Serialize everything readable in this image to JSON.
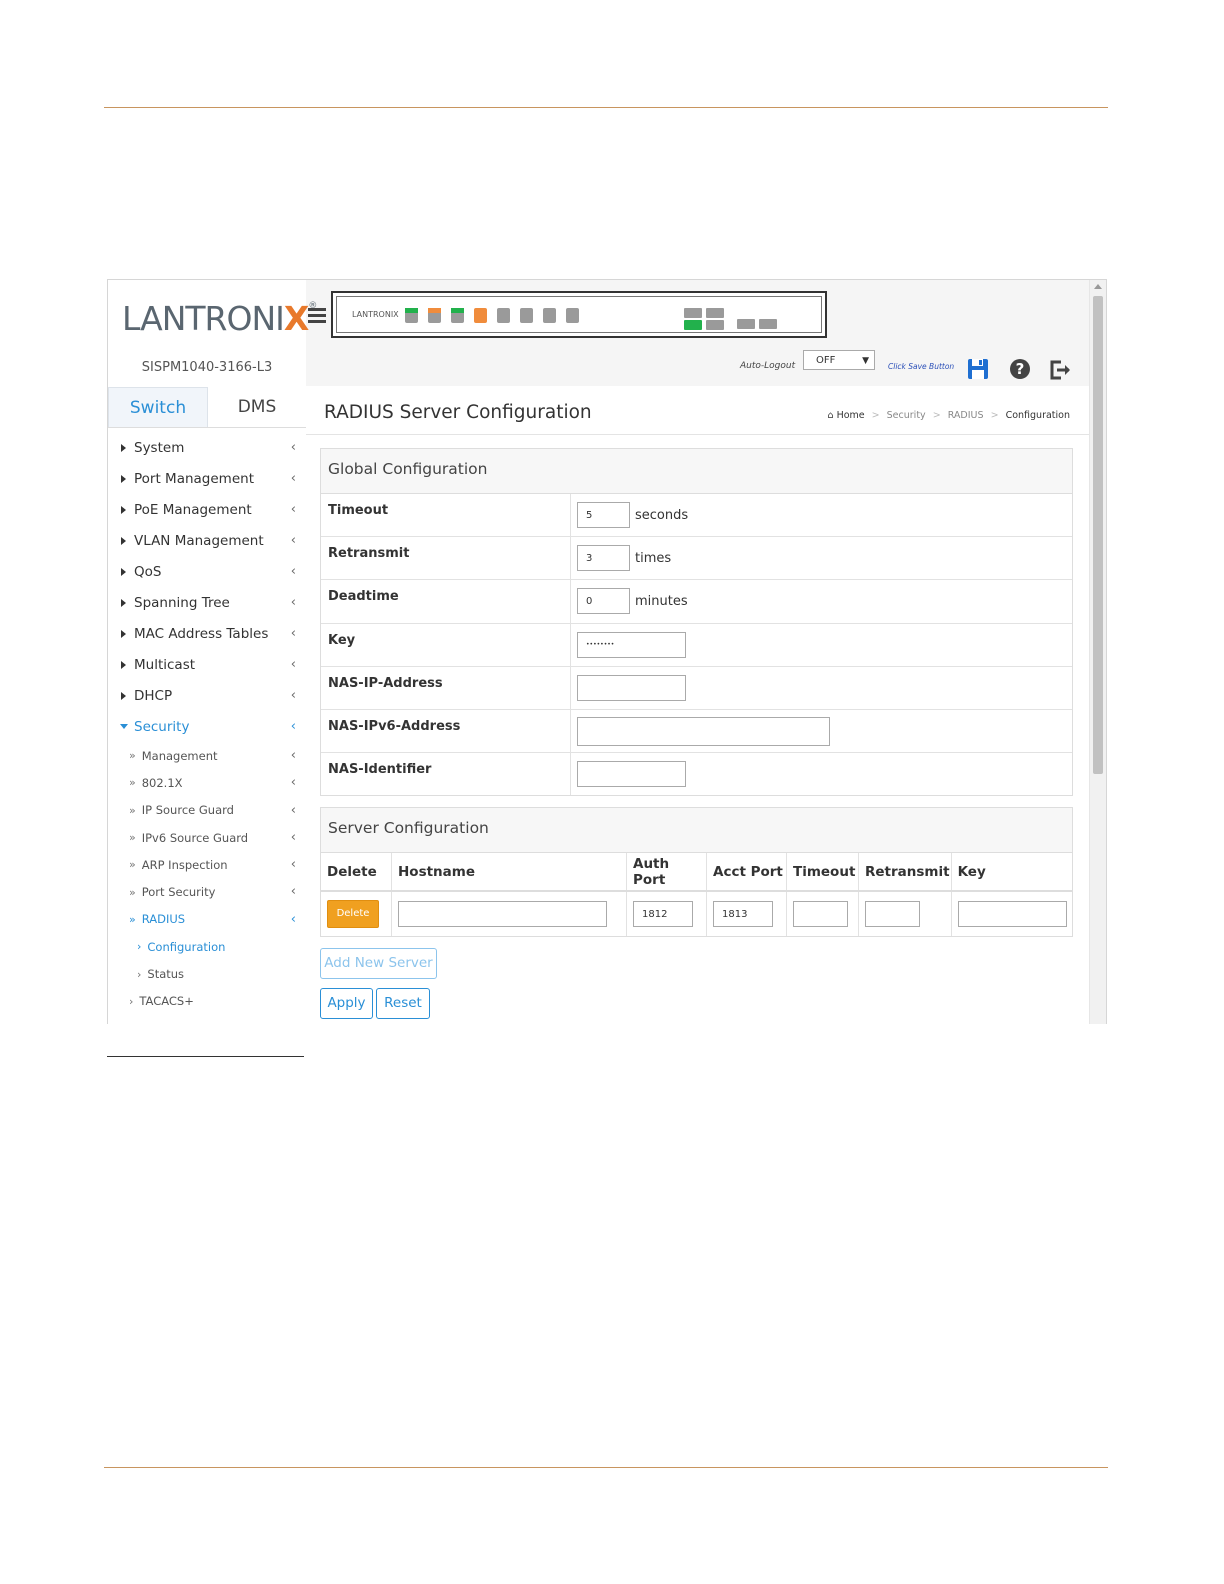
{
  "sidebar": {
    "logo_text": "LANTRONI",
    "logo_x": "X",
    "logo_reg": "®",
    "model": "SISPM1040-3166-L3",
    "tabs": [
      "Switch",
      "DMS"
    ],
    "nav": [
      {
        "label": "System"
      },
      {
        "label": "Port Management"
      },
      {
        "label": "PoE Management"
      },
      {
        "label": "VLAN Management"
      },
      {
        "label": "QoS"
      },
      {
        "label": "Spanning Tree"
      },
      {
        "label": "MAC Address Tables"
      },
      {
        "label": "Multicast"
      },
      {
        "label": "DHCP"
      },
      {
        "label": "Security"
      }
    ],
    "security_sub": [
      {
        "label": "Management"
      },
      {
        "label": "802.1X"
      },
      {
        "label": "IP Source Guard"
      },
      {
        "label": "IPv6 Source Guard"
      },
      {
        "label": "ARP Inspection"
      },
      {
        "label": "Port Security"
      },
      {
        "label": "RADIUS"
      }
    ],
    "radius_sub": [
      {
        "label": "Configuration"
      },
      {
        "label": "Status"
      }
    ],
    "tacacs": "TACACS+",
    "chevron": "‹"
  },
  "header": {
    "panel_logo": "LANTRONIX",
    "auto_logout_label": "Auto-Logout",
    "auto_logout_value": "OFF",
    "save_hint": "Click Save Button"
  },
  "page": {
    "title": "RADIUS Server Configuration",
    "breadcrumb": [
      "Home",
      "Security",
      "RADIUS",
      "Configuration"
    ],
    "breadcrumb_sep": ">"
  },
  "global": {
    "heading": "Global Configuration",
    "rows": [
      {
        "label": "Timeout",
        "value": "5",
        "unit": "seconds"
      },
      {
        "label": "Retransmit",
        "value": "3",
        "unit": "times"
      },
      {
        "label": "Deadtime",
        "value": "0",
        "unit": "minutes"
      },
      {
        "label": "Key",
        "value": "••••••••",
        "unit": ""
      },
      {
        "label": "NAS-IP-Address",
        "value": "",
        "unit": ""
      },
      {
        "label": "NAS-IPv6-Address",
        "value": "",
        "unit": ""
      },
      {
        "label": "NAS-Identifier",
        "value": "",
        "unit": ""
      }
    ]
  },
  "server": {
    "heading": "Server Configuration",
    "columns": [
      "Delete",
      "Hostname",
      "Auth Port",
      "Acct Port",
      "Timeout",
      "Retransmit",
      "Key"
    ],
    "row": {
      "delete_label": "Delete",
      "hostname": "",
      "auth_port": "1812",
      "acct_port": "1813",
      "timeout": "",
      "retransmit": "",
      "key": ""
    }
  },
  "buttons": {
    "add_new_server": "Add New Server",
    "apply": "Apply",
    "reset": "Reset"
  },
  "colors": {
    "accent": "#2a8fd6",
    "delete": "#f0a020",
    "page_rule": "#c8955f"
  }
}
